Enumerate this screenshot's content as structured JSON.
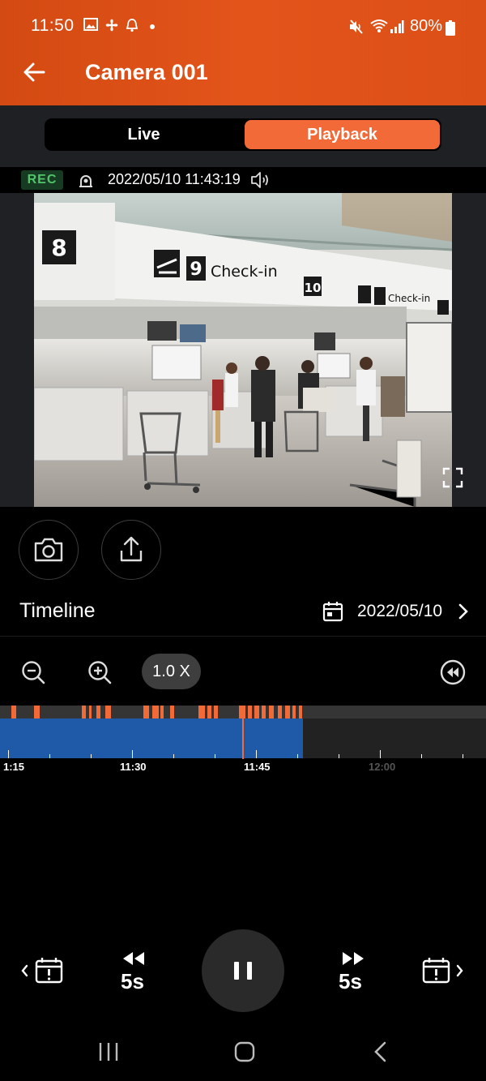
{
  "status_bar": {
    "time": "11:50",
    "battery": "80%"
  },
  "app_bar": {
    "title": "Camera 001"
  },
  "tabs": {
    "live": "Live",
    "playback": "Playback",
    "active": "Playback"
  },
  "info": {
    "rec": "REC",
    "timestamp": "2022/05/10 11:43:19"
  },
  "timeline": {
    "title": "Timeline",
    "date": "2022/05/10",
    "speed": "1.0 X",
    "labels": [
      "1:15",
      "11:30",
      "11:45",
      "12:00"
    ]
  },
  "controls": {
    "skip_back": "5s",
    "skip_forward": "5s"
  },
  "colors": {
    "accent": "#f26a37",
    "app_bar": "#e2541a",
    "recording": "#1f5aa8",
    "event": "#f26a37",
    "rec_badge": "#4fc66a"
  }
}
